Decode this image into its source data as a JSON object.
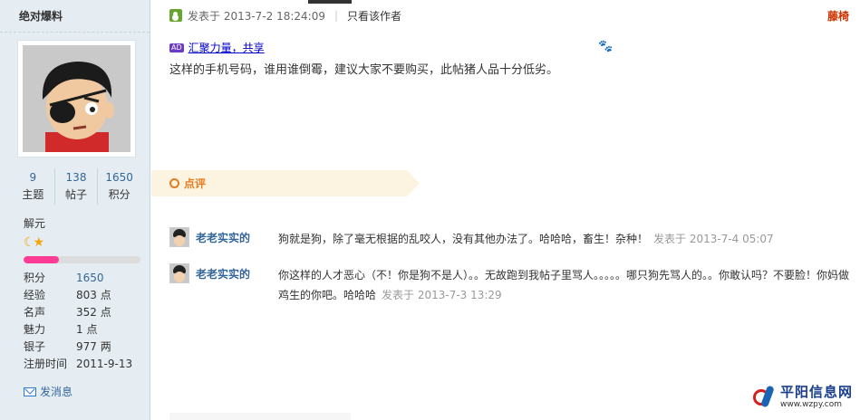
{
  "sidebar": {
    "title": "绝对爆料",
    "stats": [
      {
        "num": "9",
        "label": "主题"
      },
      {
        "num": "138",
        "label": "帖子"
      },
      {
        "num": "1650",
        "label": "积分"
      }
    ],
    "rank": "解元",
    "rank_progress_percent": 30,
    "info": [
      {
        "key": "积分",
        "value": "1650"
      },
      {
        "key": "经验",
        "value": "803 点"
      },
      {
        "key": "名声",
        "value": "352 点"
      },
      {
        "key": "魅力",
        "value": "1 点"
      },
      {
        "key": "银子",
        "value": "977 两"
      },
      {
        "key": "注册时间",
        "value": "2011-9-13"
      }
    ],
    "send_message": "发消息"
  },
  "post": {
    "published": "发表于 2013-7-2 18:24:09",
    "author_only": "只看该作者",
    "poster_name": "藤椅",
    "ad_badge": "AD",
    "ad_link": "汇聚力量，共享",
    "content": "这样的手机号码，谁用谁倒霉，建议大家不要购买，此帖猪人品十分低劣。"
  },
  "comments_section": {
    "label": "点评",
    "items": [
      {
        "user": "老老实实的",
        "text": "狗就是狗，除了毫无根据的乱咬人，没有其他办法了。哈哈哈，畜生！杂种！",
        "time": "发表于 2013-7-4 05:07"
      },
      {
        "user": "老老实实的",
        "text": "你这样的人才恶心（不！你是狗不是人）。。无故跑到我帖子里骂人。。。。。哪只狗先骂人的。。你敢认吗？不要脸！你妈做鸡生的你吧。哈哈哈",
        "time": "发表于 2013-7-3 13:29"
      }
    ]
  },
  "watermark": {
    "name": "平阳信息网",
    "url": "www.wzpy.com"
  }
}
